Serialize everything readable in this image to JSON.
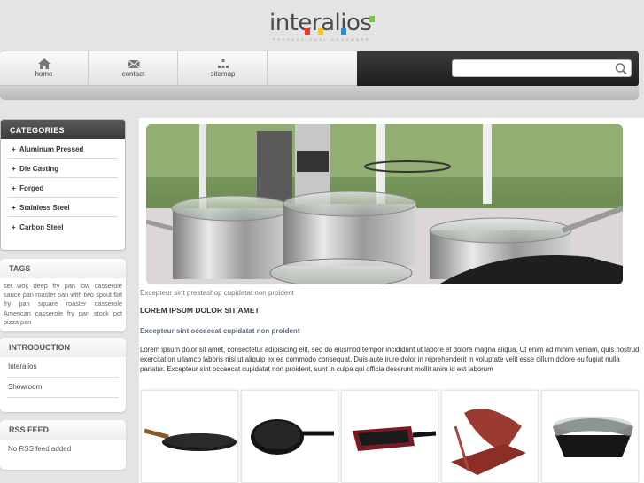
{
  "logo": {
    "text": "interalios",
    "tagline": "PROFESSIONAL COOKWARE"
  },
  "colors": {
    "logo_red": "#e63d2f",
    "logo_green": "#79c143",
    "logo_blue": "#2a8fd8",
    "logo_yellow": "#f2c61b",
    "subheading_blue": "#5b6d86"
  },
  "nav": {
    "items": [
      {
        "label": "home",
        "icon": "home-icon"
      },
      {
        "label": "contact",
        "icon": "envelope-icon"
      },
      {
        "label": "sitemap",
        "icon": "sitemap-icon"
      }
    ],
    "search": {
      "placeholder": "",
      "icon": "magnifier-icon"
    }
  },
  "categories": {
    "title": "CATEGORIES",
    "items": [
      "Aluminum Pressed",
      "Die Casting",
      "Forged",
      "Stainless Steel",
      "Carbon Steel"
    ],
    "bullet": "+"
  },
  "tags": {
    "title": "TAGS",
    "text": "set wok deep fry pan low casserole sauce pan roaster pan with two spout flat fry pan square roaster casserole American casserole fry pan stock pot pizza pan"
  },
  "introduction": {
    "title": "INTRODUCTION",
    "items": [
      "Interalios",
      "Showroom"
    ]
  },
  "rss": {
    "title": "RSS FEED",
    "text": "No RSS feed added"
  },
  "main": {
    "caption": "Excepteur sint prestashop cupidatat non proident",
    "heading": "LOREM IPSUM DOLOR SIT AMET",
    "subheading": "Excepteur sint occaecat cupidatat non proident",
    "paragraph": "Lorem ipsum dolor sit amet, consectetur adipisicing elit, sed do eiusmod tempor incididunt ut labore et dolore magna aliqua. Ut enim ad minim veniam, quis nostrud exercitation ullamco laboris nisi ut aliquip ex ea commodo consequat. Duis aute irure dolor in reprehenderit in voluptate velit esse cillum dolore eu fugiat nulla pariatur. Excepteur sint occaecat cupidatat non proident, sunt in culpa qui officia deserunt mollit anim id est laborum",
    "products": [
      "flat-pan-long-handle",
      "black-fry-pan",
      "square-grill-pan",
      "double-sided-pan",
      "black-roaster"
    ]
  }
}
